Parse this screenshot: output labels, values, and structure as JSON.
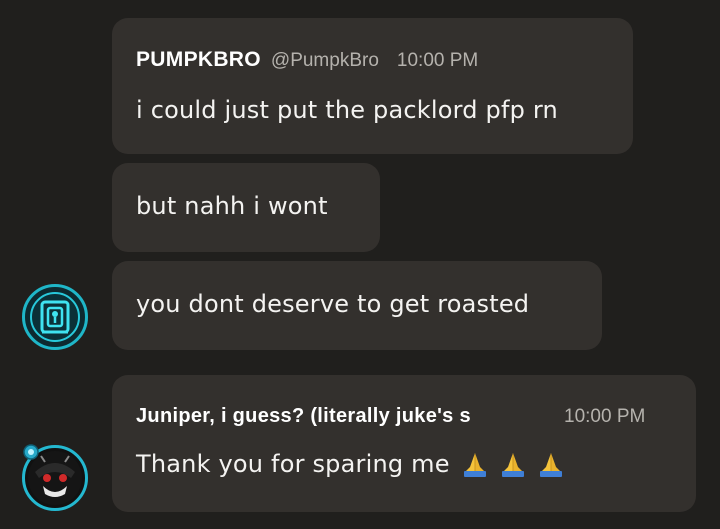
{
  "messages": [
    {
      "author": "PUMPKBRO",
      "handle": "@PumpkBro",
      "time": "10:00 PM",
      "text": "i could just put the packlord pfp rn"
    },
    {
      "text": "but nahh i wont"
    },
    {
      "text": "you dont deserve to get roasted"
    },
    {
      "author": "Juniper, i guess? (literally juke's s",
      "time": "10:00 PM",
      "text": "Thank you for sparing me",
      "emojis": [
        "folded-hands",
        "folded-hands",
        "folded-hands"
      ]
    }
  ],
  "avatars": {
    "pumpkbro": "cyan-maze-logo-icon",
    "juniper": "dark-character-avatar-icon"
  },
  "colors": {
    "background": "#201f1d",
    "bubble": "#33302d",
    "accent_cyan": "#1fb6c8",
    "muted_text": "#b5b2ad"
  }
}
